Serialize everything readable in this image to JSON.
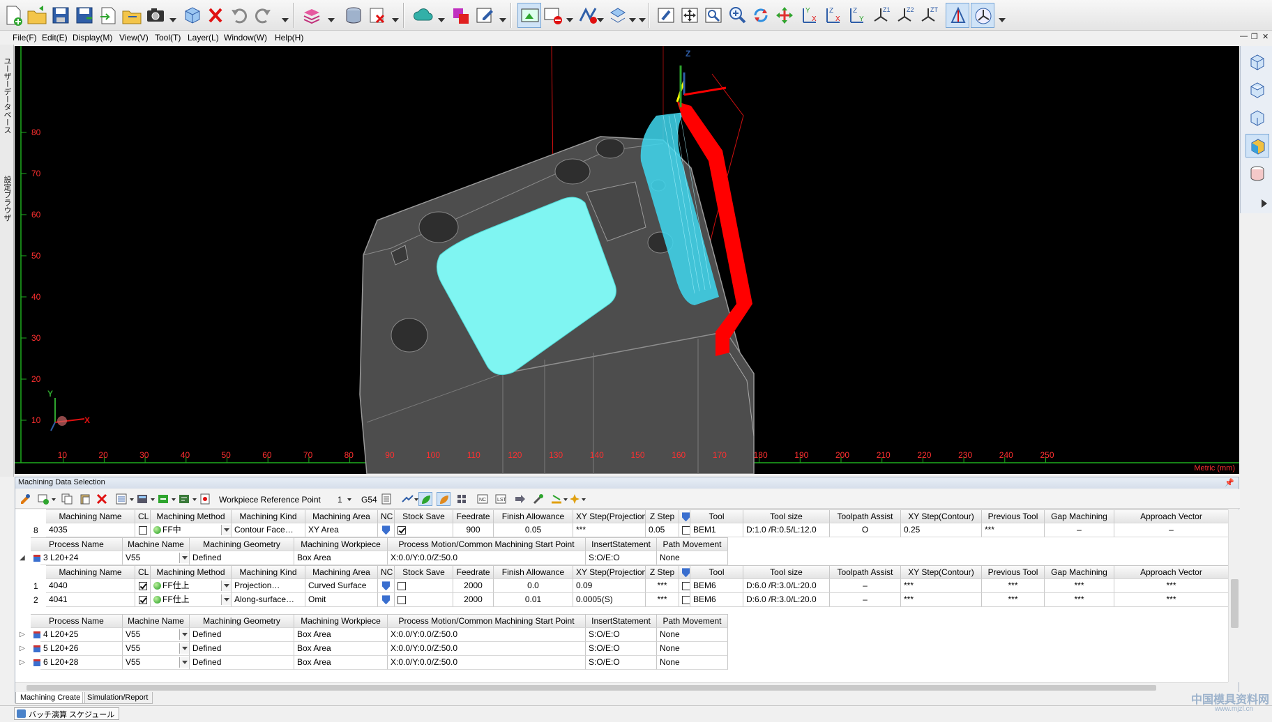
{
  "menu": [
    "File(F)",
    "Edit(E)",
    "Display(M)",
    "View(V)",
    "Tool(T)",
    "Layer(L)",
    "Window(W)",
    "Help(H)"
  ],
  "left_tabs": [
    "ユーザーデータベース",
    "設定ブラウザ"
  ],
  "viewport": {
    "y_ticks": [
      "80",
      "70",
      "60",
      "50",
      "40",
      "30",
      "20",
      "10"
    ],
    "x_ticks": [
      "10",
      "20",
      "30",
      "40",
      "50",
      "60",
      "70",
      "80",
      "90",
      "100",
      "110",
      "120",
      "130",
      "140",
      "150",
      "160",
      "170",
      "180",
      "190",
      "200",
      "210",
      "220",
      "230",
      "240",
      "250"
    ],
    "units": "Metric (mm)",
    "axis_x": "X",
    "axis_y": "Y",
    "axis_z": "Z",
    "colors": {
      "background": "#000000",
      "model": "#555555",
      "surface": "#7ff5f2",
      "toolpath": "#ff0000",
      "ruler": "#ff3030"
    }
  },
  "panel": {
    "title": "Machining Data Selection",
    "toolbar": {
      "ref_label": "Workpiece Reference Point",
      "ref_value": "1",
      "coord": "G54"
    },
    "tool_cols": [
      "Machining Name",
      "CL",
      "Machining Method",
      "Machining Kind",
      "Machining Area",
      "NC",
      "Stock Save",
      "Feedrate",
      "Finish Allowance",
      "XY Step(Projection)",
      "Z Step",
      "",
      "Tool",
      "Tool size",
      "Toolpath Assist",
      "XY Step(Contour)",
      "Previous Tool",
      "Gap Machining",
      "Approach Vector"
    ],
    "proc_cols": [
      "Process Name",
      "Machine Name",
      "Machining Geometry",
      "Machining Workpiece",
      "Process Motion/Common Machining Start Point",
      "InsertStatement",
      "Path Movement"
    ],
    "row8": {
      "no": "8",
      "name": "4035",
      "method": "FF中",
      "kind": "Contour Face…",
      "area": "XY Area",
      "feed": "900",
      "allow": "0.05",
      "xy": "***",
      "z": "0.05",
      "tool": "BEM1",
      "size": "D:1.0 /R:0.5/L:12.0",
      "assist": "O",
      "xyc": "0.25",
      "prev": "***",
      "gap": "–",
      "approach": "–"
    },
    "processes": [
      {
        "no": "3",
        "name": "L20+24",
        "machine": "V55",
        "geometry": "Defined",
        "workpiece": "Box Area",
        "start": "X:0.0/Y:0.0/Z:50.0",
        "insert": "S:O/E:O",
        "path": "None"
      },
      {
        "no": "4",
        "name": "L20+25",
        "machine": "V55",
        "geometry": "Defined",
        "workpiece": "Box Area",
        "start": "X:0.0/Y:0.0/Z:50.0",
        "insert": "S:O/E:O",
        "path": "None"
      },
      {
        "no": "5",
        "name": "L20+26",
        "machine": "V55",
        "geometry": "Defined",
        "workpiece": "Box Area",
        "start": "X:0.0/Y:0.0/Z:50.0",
        "insert": "S:O/E:O",
        "path": "None"
      },
      {
        "no": "6",
        "name": "L20+28",
        "machine": "V55",
        "geometry": "Defined",
        "workpiece": "Box Area",
        "start": "X:0.0/Y:0.0/Z:50.0",
        "insert": "S:O/E:O",
        "path": "None"
      }
    ],
    "ops": [
      {
        "no": "1",
        "name": "4040",
        "method": "FF仕上",
        "kind": "Projection…",
        "area": "Curved Surface",
        "feed": "2000",
        "allow": "0.0",
        "xy": "0.09",
        "z": "***",
        "tool": "BEM6",
        "size": "D:6.0 /R:3.0/L:20.0",
        "assist": "–",
        "xyc": "***",
        "prev": "***",
        "gap": "***",
        "approach": "***"
      },
      {
        "no": "2",
        "name": "4041",
        "method": "FF仕上",
        "kind": "Along-surface…",
        "area": "Omit",
        "feed": "2000",
        "allow": "0.01",
        "xy": "0.0005(S)",
        "z": "***",
        "tool": "BEM6",
        "size": "D:6.0 /R:3.0/L:20.0",
        "assist": "–",
        "xyc": "***",
        "prev": "***",
        "gap": "***",
        "approach": "***"
      }
    ],
    "tabs": [
      "Machining Create",
      "Simulation/Report"
    ]
  },
  "status": {
    "batch_label": "バッチ演算 スケジュール"
  },
  "watermark": {
    "line1": "中国模具资料网",
    "line2": "www.mjzl.cn"
  }
}
